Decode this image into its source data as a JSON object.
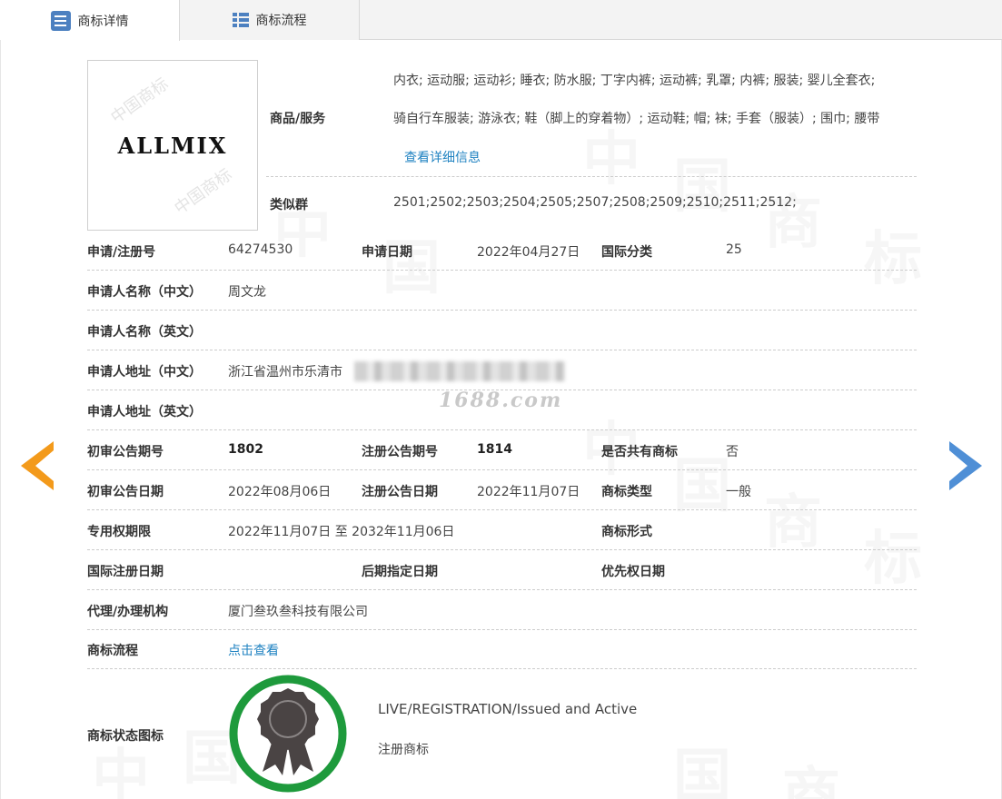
{
  "tabs": [
    {
      "label": "商标详情",
      "active": true,
      "icon": "list-doc-icon"
    },
    {
      "label": "商标流程",
      "active": false,
      "icon": "table-list-icon"
    }
  ],
  "trademark": {
    "logo_text": "ALLMIX",
    "logo_watermark": "中国商标"
  },
  "goods": {
    "label": "商品/服务",
    "line1": "内衣; 运动服; 运动衫; 睡衣; 防水服; 丁字内裤; 运动裤; 乳罩; 内裤; 服装; 婴儿全套衣;",
    "line2": "骑自行车服装; 游泳衣; 鞋（脚上的穿着物）; 运动鞋; 帽; 袜; 手套（服装）; 围巾; 腰带",
    "detail_link": "查看详细信息"
  },
  "similar_group": {
    "label": "类似群",
    "value": "2501;2502;2503;2504;2505;2507;2508;2509;2510;2511;2512;"
  },
  "rows": {
    "reg_no_label": "申请/注册号",
    "reg_no": "64274530",
    "apply_date_label": "申请日期",
    "apply_date": "2022年04月27日",
    "intl_class_label": "国际分类",
    "intl_class": "25",
    "applicant_cn_label": "申请人名称（中文）",
    "applicant_cn": "周文龙",
    "applicant_en_label": "申请人名称（英文）",
    "applicant_en": "",
    "address_cn_label": "申请人地址（中文）",
    "address_cn": "浙江省温州市乐清市",
    "address_en_label": "申请人地址（英文）",
    "address_en": "",
    "prelim_no_label": "初审公告期号",
    "prelim_no": "1802",
    "reg_pub_no_label": "注册公告期号",
    "reg_pub_no": "1814",
    "shared_label": "是否共有商标",
    "shared": "否",
    "prelim_date_label": "初审公告日期",
    "prelim_date": "2022年08月06日",
    "reg_pub_date_label": "注册公告日期",
    "reg_pub_date": "2022年11月07日",
    "tm_type_label": "商标类型",
    "tm_type": "一般",
    "exclusive_label": "专用权期限",
    "exclusive": "2022年11月07日 至 2032年11月06日",
    "tm_form_label": "商标形式",
    "tm_form": "",
    "intl_reg_date_label": "国际注册日期",
    "intl_reg_date": "",
    "later_designation_label": "后期指定日期",
    "later_designation": "",
    "priority_date_label": "优先权日期",
    "priority_date": "",
    "agent_label": "代理/办理机构",
    "agent": "厦门叁玖叁科技有限公司",
    "flow_label": "商标流程",
    "flow_link": "点击查看",
    "status_icon_label": "商标状态图标",
    "status_en": "LIVE/REGISTRATION/Issued and Active",
    "status_cn": "注册商标"
  },
  "site_watermark": "1688.com",
  "background_watermark": "中国商标",
  "colors": {
    "link": "#1f82c1",
    "prev_arrow": "#f39a1b",
    "next_arrow": "#4f8fd6",
    "badge_ring": "#1e9a3c",
    "badge_medal": "#4a4444"
  }
}
